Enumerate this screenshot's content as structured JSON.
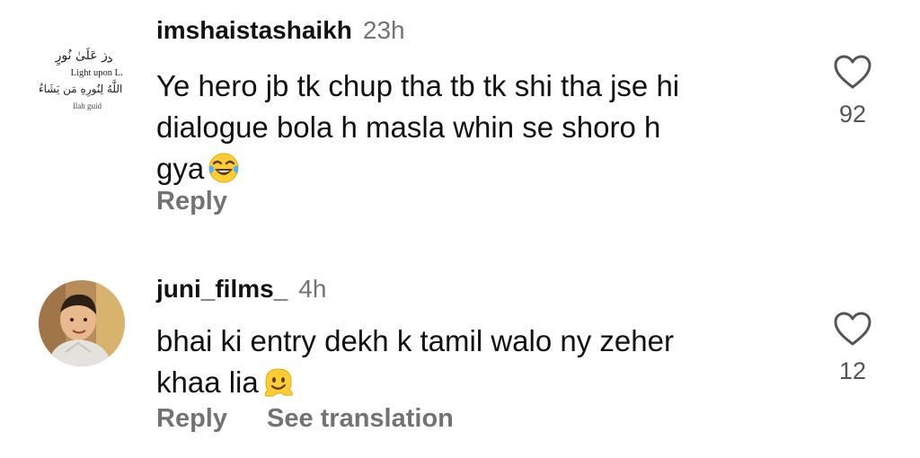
{
  "comments": [
    {
      "username": "imshaistashaikh",
      "time": "23h",
      "text": "Ye hero jb tk chup tha tb tk shi tha jse hi\ndialogue bola h masla whin se shoro h\ngya",
      "emoji": "face-with-tears-of-joy",
      "likes": "92",
      "actions": [
        "Reply"
      ],
      "avatar": {
        "type": "logo",
        "arabic_top": "نُورٌ عَلَىٰ نُورٍ",
        "english": "Light upon Li",
        "arabic_bottom": "يَهْدِي اللَّهُ لِنُورِهِ مَن يَشَاءُ",
        "english_bottom": "llah guid"
      }
    },
    {
      "username": "juni_films_",
      "time": "4h",
      "text": "bhai ki entry dekh k tamil walo ny zeher\nkhaa lia",
      "emoji": "melting-face",
      "likes": "12",
      "actions": [
        "Reply",
        "See translation"
      ],
      "avatar": {
        "type": "photo"
      }
    }
  ],
  "colors": {
    "text": "#111111",
    "secondary": "#737373",
    "background": "#ffffff"
  }
}
